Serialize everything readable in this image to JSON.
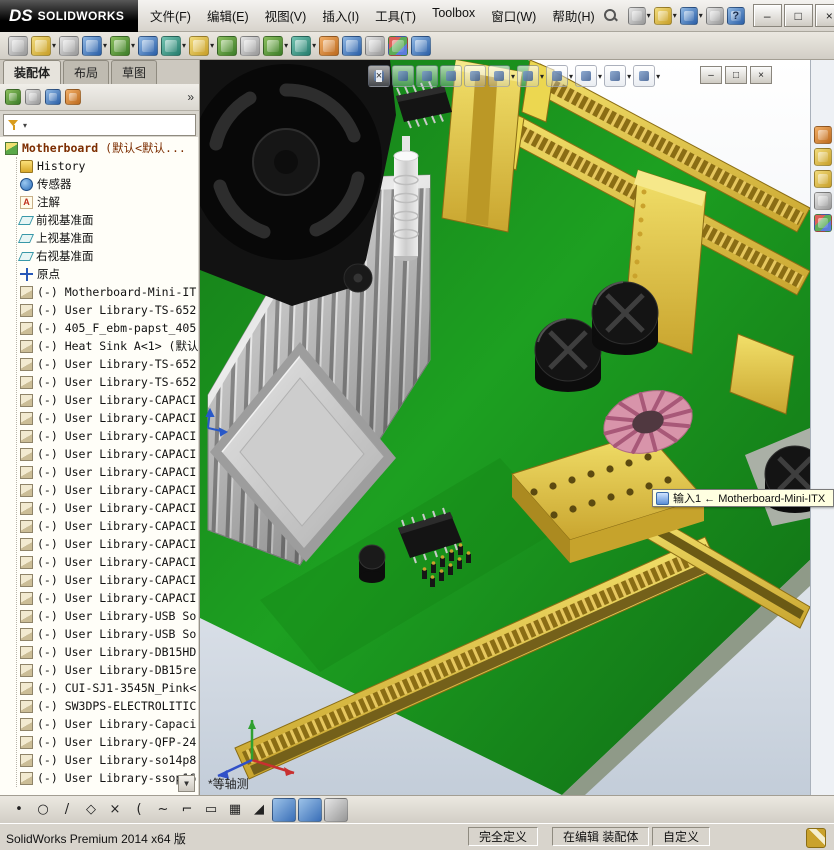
{
  "titlebar": {
    "logo_ds": "DS",
    "logo_text": "SOLIDWORKS",
    "menus": [
      {
        "name": "menu-file",
        "label": "文件(F)"
      },
      {
        "name": "menu-edit",
        "label": "编辑(E)"
      },
      {
        "name": "menu-view",
        "label": "视图(V)"
      },
      {
        "name": "menu-insert",
        "label": "插入(I)"
      },
      {
        "name": "menu-tools",
        "label": "工具(T)"
      },
      {
        "name": "menu-toolbox",
        "label": "Toolbox"
      },
      {
        "name": "menu-window",
        "label": "窗口(W)"
      },
      {
        "name": "menu-help",
        "label": "帮助(H)"
      }
    ],
    "quick_icons": [
      {
        "name": "new-document-button",
        "cls": "c-gray",
        "caret": "▾"
      },
      {
        "name": "open-document-button",
        "cls": "c-yellow",
        "caret": "▾"
      },
      {
        "name": "save-button",
        "cls": "c-blue",
        "caret": "▾"
      },
      {
        "name": "print-button",
        "cls": "c-gray"
      },
      {
        "name": "help-button",
        "cls": "c-blue",
        "glyph": "?"
      }
    ],
    "window_buttons": [
      {
        "name": "minimize-button",
        "glyph": "–"
      },
      {
        "name": "maximize-button",
        "glyph": "□"
      },
      {
        "name": "close-button",
        "glyph": "×"
      }
    ]
  },
  "main_toolbar": {
    "icons": [
      {
        "name": "print-icon",
        "cls": "c-gray"
      },
      {
        "name": "edit-component-icon",
        "cls": "c-yellow",
        "caret": "▾"
      },
      {
        "name": "attachments-icon",
        "cls": "c-gray"
      },
      {
        "name": "insert-components-icon",
        "cls": "c-blue",
        "caret": "▾"
      },
      {
        "name": "mate-icon",
        "cls": "c-green",
        "caret": "▾"
      },
      {
        "name": "component-preview-icon",
        "cls": "c-blue"
      },
      {
        "name": "smart-fasteners-icon",
        "cls": "c-teal",
        "caret": "▾"
      },
      {
        "name": "linear-component-pattern-icon",
        "cls": "c-yellow",
        "caret": "▾"
      },
      {
        "name": "move-component-icon",
        "cls": "c-green"
      },
      {
        "name": "rotate-component-icon",
        "cls": "c-gray"
      },
      {
        "name": "assembly-features-icon",
        "cls": "c-green",
        "caret": "▾"
      },
      {
        "name": "reference-geometry-icon",
        "cls": "c-teal",
        "caret": "▾"
      },
      {
        "name": "new-motion-study-icon",
        "cls": "c-orange"
      },
      {
        "name": "interference-detection-icon",
        "cls": "c-blue"
      },
      {
        "name": "measure-icon",
        "cls": "c-gray"
      },
      {
        "name": "exploded-view-icon",
        "cls": "c-multi"
      },
      {
        "name": "instant3d-icon",
        "cls": "c-blue"
      }
    ]
  },
  "command_manager": {
    "tabs": [
      {
        "name": "tab-assembly",
        "label": "装配体",
        "cls": "active"
      },
      {
        "name": "tab-layout",
        "label": "布局",
        "cls": "plain"
      },
      {
        "name": "tab-sketch",
        "label": "草图",
        "cls": "plain"
      }
    ]
  },
  "feature_panel": {
    "tab_icons": [
      {
        "name": "featuremanager-tree-tab",
        "cls": "c-green"
      },
      {
        "name": "propertymanager-tab",
        "cls": "c-gray"
      },
      {
        "name": "configurationmanager-tab",
        "cls": "c-blue"
      },
      {
        "name": "displaymanager-tab",
        "cls": "c-orange"
      }
    ],
    "chevron": "»",
    "filter_caret": "▾",
    "scroll_glyph": "▼",
    "tree": {
      "root": {
        "label": "Motherboard",
        "suffix": "(默认<默认..."
      },
      "items": [
        {
          "cls": "t-hist",
          "label": "History"
        },
        {
          "cls": "t-sensor",
          "label": "传感器"
        },
        {
          "cls": "t-ann",
          "label": "注解"
        },
        {
          "cls": "t-plane",
          "label": "前视基准面"
        },
        {
          "cls": "t-plane",
          "label": "上视基准面"
        },
        {
          "cls": "t-plane",
          "label": "右视基准面"
        },
        {
          "cls": "t-origin",
          "label": "原点"
        },
        {
          "cls": "t-part",
          "label": "(-) Motherboard-Mini-IT"
        },
        {
          "cls": "t-part",
          "label": "(-) User Library-TS-652"
        },
        {
          "cls": "t-part",
          "label": "(-) 405_F_ebm-papst_405"
        },
        {
          "cls": "t-part",
          "label": "(-) Heat Sink A<1> (默认"
        },
        {
          "cls": "t-part",
          "label": "(-) User Library-TS-652"
        },
        {
          "cls": "t-part",
          "label": "(-) User Library-TS-652"
        },
        {
          "cls": "t-part",
          "label": "(-) User Library-CAPACI"
        },
        {
          "cls": "t-part",
          "label": "(-) User Library-CAPACI"
        },
        {
          "cls": "t-part",
          "label": "(-) User Library-CAPACI"
        },
        {
          "cls": "t-part",
          "label": "(-) User Library-CAPACI"
        },
        {
          "cls": "t-part",
          "label": "(-) User Library-CAPACI"
        },
        {
          "cls": "t-part",
          "label": "(-) User Library-CAPACI"
        },
        {
          "cls": "t-part",
          "label": "(-) User Library-CAPACI"
        },
        {
          "cls": "t-part",
          "label": "(-) User Library-CAPACI"
        },
        {
          "cls": "t-part",
          "label": "(-) User Library-CAPACI"
        },
        {
          "cls": "t-part",
          "label": "(-) User Library-CAPACI"
        },
        {
          "cls": "t-part",
          "label": "(-) User Library-CAPACI"
        },
        {
          "cls": "t-part",
          "label": "(-) User Library-CAPACI"
        },
        {
          "cls": "t-part",
          "label": "(-) User Library-USB So"
        },
        {
          "cls": "t-part",
          "label": "(-) User Library-USB So"
        },
        {
          "cls": "t-part",
          "label": "(-) User Library-DB15HD"
        },
        {
          "cls": "t-part",
          "label": "(-) User Library-DB15re"
        },
        {
          "cls": "t-part",
          "label": "(-) CUI-SJ1-3545N_Pink<"
        },
        {
          "cls": "t-part",
          "label": "(-) SW3DPS-ELECTROLITIC"
        },
        {
          "cls": "t-part",
          "label": "(-) User Library-Capaci"
        },
        {
          "cls": "t-part",
          "label": "(-) User Library-QFP-24"
        },
        {
          "cls": "t-part",
          "label": "(-) User Library-so14p8"
        },
        {
          "cls": "t-part",
          "label": "(-) User Library-ssop16"
        }
      ]
    }
  },
  "viewport": {
    "headsup": [
      {
        "name": "close-flyout-icon",
        "glyph": "×"
      },
      {
        "name": "zoom-to-fit-icon"
      },
      {
        "name": "zoom-to-area-icon"
      },
      {
        "name": "previous-view-icon"
      },
      {
        "name": "section-view-icon"
      },
      {
        "name": "view-orientation-icon",
        "caret": "▾"
      },
      {
        "name": "display-style-icon",
        "caret": "▾"
      },
      {
        "name": "hide-show-items-icon",
        "caret": "▾"
      },
      {
        "name": "edit-appearance-icon",
        "caret": "▾"
      },
      {
        "name": "apply-scene-icon",
        "caret": "▾"
      },
      {
        "name": "view-settings-icon",
        "caret": "▾"
      }
    ],
    "doc_controls": [
      {
        "name": "document-minimize-button",
        "glyph": "–"
      },
      {
        "name": "document-restore-button",
        "glyph": "□"
      },
      {
        "name": "document-close-button",
        "glyph": "×"
      }
    ],
    "view_label": "*等轴测",
    "tooltip": "输入1 ← Motherboard-Mini-ITX",
    "colors": {
      "pcb_green": "#1d9e21",
      "connector_yellow": "#e8d44c",
      "heatsink_gray": "#c2c2c2",
      "background_bottom": "#c3cdd9"
    }
  },
  "task_pane": {
    "icons": [
      {
        "name": "solidworks-resources-icon",
        "cls": "c-orange"
      },
      {
        "name": "design-library-icon",
        "cls": "c-yellow"
      },
      {
        "name": "file-explorer-icon",
        "cls": "c-yellow"
      },
      {
        "name": "view-palette-icon",
        "cls": "c-gray"
      },
      {
        "name": "appearances-scenes-icon",
        "cls": "c-multi"
      }
    ]
  },
  "sketch_toolbar": {
    "icons": [
      {
        "name": "sketch-point-icon",
        "glyph": "•"
      },
      {
        "name": "sketch-circle-icon",
        "glyph": "○"
      },
      {
        "name": "sketch-line-icon",
        "glyph": "/"
      },
      {
        "name": "sketch-polygon-icon",
        "glyph": "◇"
      },
      {
        "name": "sketch-erase-icon",
        "glyph": "×"
      },
      {
        "name": "sketch-arc-icon",
        "glyph": "("
      },
      {
        "name": "sketch-spline-icon",
        "glyph": "~"
      },
      {
        "name": "sketch-corner-rectangle-icon",
        "glyph": "⌐"
      },
      {
        "name": "sketch-rectangle-icon",
        "glyph": "▭"
      },
      {
        "name": "sketch-pattern-icon",
        "glyph": "▦"
      },
      {
        "name": "sketch-fillet-icon",
        "glyph": "◢"
      },
      {
        "name": "shaded-sketch-contours-icon",
        "cls": "c-blue"
      },
      {
        "name": "grid-snap-icon",
        "cls": "c-blue"
      },
      {
        "name": "sketch-settings-icon",
        "cls": "c-gray"
      }
    ]
  },
  "statusbar": {
    "app_version": "SolidWorks Premium 2014 x64 版",
    "fully_defined": "完全定义",
    "editing": "在编辑 装配体",
    "custom": "自定义",
    "pencil_icon": "pencil"
  }
}
